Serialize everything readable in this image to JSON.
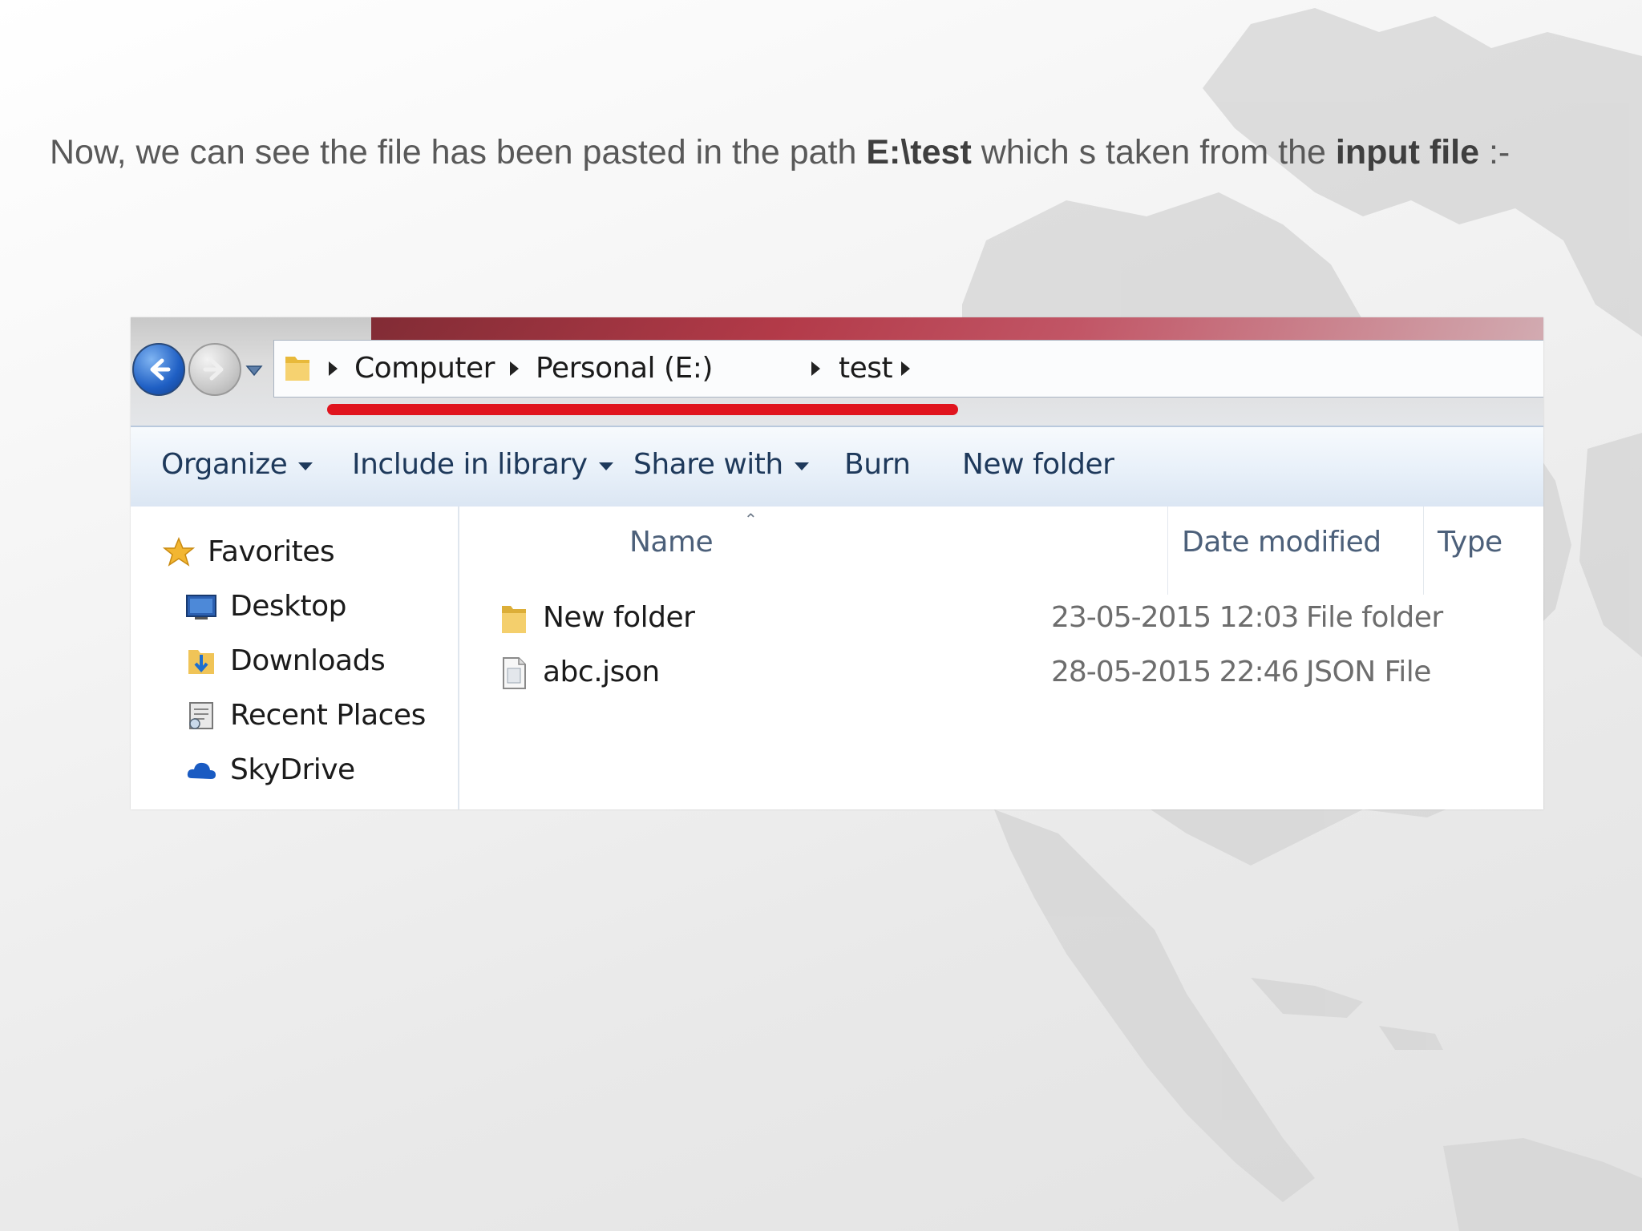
{
  "caption": {
    "prefix": "Now,  we can see the file has been pasted in the path ",
    "path": "E:\\test",
    "middle": "  which s taken from the ",
    "emphasis": "input file",
    "suffix": " :-"
  },
  "explorer": {
    "breadcrumbs": [
      "Computer",
      "Personal (E:)",
      "test"
    ],
    "toolbar": [
      "Organize",
      "Include in library",
      "Share with",
      "Burn",
      "New folder"
    ],
    "nav": {
      "favorites": "Favorites",
      "items": [
        "Desktop",
        "Downloads",
        "Recent Places",
        "SkyDrive"
      ]
    },
    "columns": {
      "name": "Name",
      "date": "Date modified",
      "type": "Type"
    },
    "files": [
      {
        "name": "New folder",
        "date": "23-05-2015 12:03",
        "type": "File folder",
        "icon": "folder-icon"
      },
      {
        "name": "abc.json",
        "date": "28-05-2015 22:46",
        "type": "JSON File",
        "icon": "file-icon"
      }
    ]
  },
  "colors": {
    "highlight_underline": "#e0141e",
    "accent_bar": "#b02a3a"
  }
}
